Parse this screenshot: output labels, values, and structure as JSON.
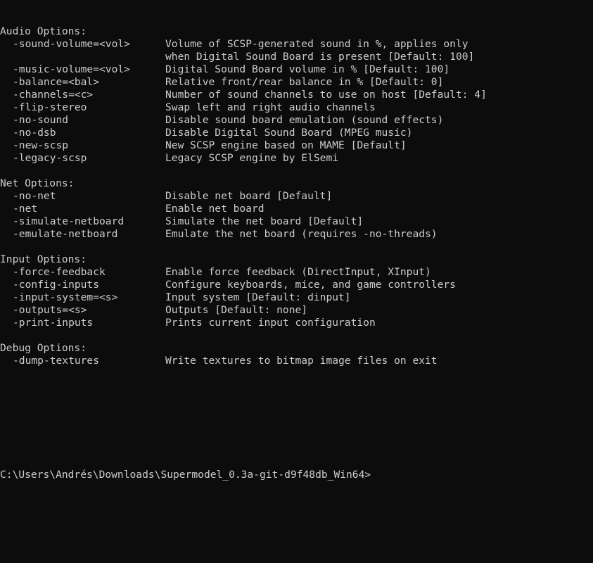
{
  "colors": {
    "background": "#0c0c0c",
    "foreground": "#cccccc"
  },
  "sections": [
    {
      "title": "Audio Options:",
      "options": [
        {
          "flag": "-sound-volume=<vol>",
          "desc": [
            "Volume of SCSP-generated sound in %, applies only",
            "when Digital Sound Board is present [Default: 100]"
          ]
        },
        {
          "flag": "-music-volume=<vol>",
          "desc": [
            "Digital Sound Board volume in % [Default: 100]"
          ]
        },
        {
          "flag": "-balance=<bal>",
          "desc": [
            "Relative front/rear balance in % [Default: 0]"
          ]
        },
        {
          "flag": "-channels=<c>",
          "desc": [
            "Number of sound channels to use on host [Default: 4]"
          ]
        },
        {
          "flag": "-flip-stereo",
          "desc": [
            "Swap left and right audio channels"
          ]
        },
        {
          "flag": "-no-sound",
          "desc": [
            "Disable sound board emulation (sound effects)"
          ]
        },
        {
          "flag": "-no-dsb",
          "desc": [
            "Disable Digital Sound Board (MPEG music)"
          ]
        },
        {
          "flag": "-new-scsp",
          "desc": [
            "New SCSP engine based on MAME [Default]"
          ]
        },
        {
          "flag": "-legacy-scsp",
          "desc": [
            "Legacy SCSP engine by ElSemi"
          ]
        }
      ]
    },
    {
      "title": "Net Options:",
      "options": [
        {
          "flag": "-no-net",
          "desc": [
            "Disable net board [Default]"
          ]
        },
        {
          "flag": "-net",
          "desc": [
            "Enable net board"
          ]
        },
        {
          "flag": "-simulate-netboard",
          "desc": [
            "Simulate the net board [Default]"
          ]
        },
        {
          "flag": "-emulate-netboard",
          "desc": [
            "Emulate the net board (requires -no-threads)"
          ]
        }
      ]
    },
    {
      "title": "Input Options:",
      "options": [
        {
          "flag": "-force-feedback",
          "desc": [
            "Enable force feedback (DirectInput, XInput)"
          ]
        },
        {
          "flag": "-config-inputs",
          "desc": [
            "Configure keyboards, mice, and game controllers"
          ]
        },
        {
          "flag": "-input-system=<s>",
          "desc": [
            "Input system [Default: dinput]"
          ]
        },
        {
          "flag": "-outputs=<s>",
          "desc": [
            "Outputs [Default: none]"
          ]
        },
        {
          "flag": "-print-inputs",
          "desc": [
            "Prints current input configuration"
          ]
        }
      ]
    },
    {
      "title": "Debug Options:",
      "options": [
        {
          "flag": "-dump-textures",
          "desc": [
            "Write textures to bitmap image files on exit"
          ]
        }
      ]
    }
  ],
  "prompt": "C:\\Users\\Andrés\\Downloads\\Supermodel_0.3a-git-d9f48db_Win64>"
}
